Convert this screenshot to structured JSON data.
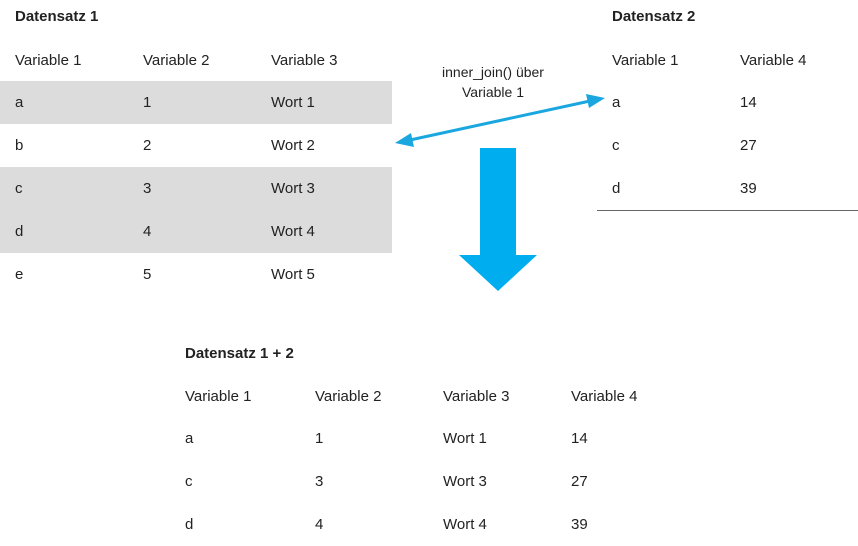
{
  "dataset1": {
    "title": "Datensatz 1",
    "headers": [
      "Variable 1",
      "Variable 2",
      "Variable 3"
    ],
    "rows": [
      [
        "a",
        "1",
        "Wort 1"
      ],
      [
        "b",
        "2",
        "Wort 2"
      ],
      [
        "c",
        "3",
        "Wort 3"
      ],
      [
        "d",
        "4",
        "Wort 4"
      ],
      [
        "e",
        "5",
        "Wort 5"
      ]
    ],
    "shaded_rows": [
      0,
      2,
      3
    ]
  },
  "dataset2": {
    "title": "Datensatz 2",
    "headers": [
      "Variable 1",
      "Variable 4"
    ],
    "rows": [
      [
        "a",
        "14"
      ],
      [
        "c",
        "27"
      ],
      [
        "d",
        "39"
      ]
    ]
  },
  "join_label": {
    "line1": "inner_join() über",
    "line2": "Variable 1"
  },
  "result": {
    "title": "Datensatz 1 + 2",
    "headers": [
      "Variable 1",
      "Variable 2",
      "Variable 3",
      "Variable 4"
    ],
    "rows": [
      [
        "a",
        "1",
        "Wort 1",
        "14"
      ],
      [
        "c",
        "3",
        "Wort 3",
        "27"
      ],
      [
        "d",
        "4",
        "Wort 4",
        "39"
      ]
    ]
  },
  "colors": {
    "arrow": "#1aa7e0",
    "shade": "#dcdcdc",
    "rule": "#666666"
  }
}
